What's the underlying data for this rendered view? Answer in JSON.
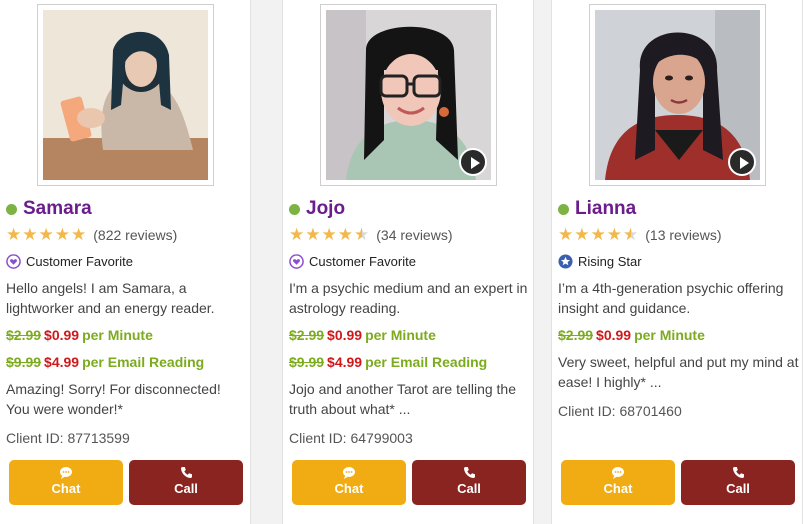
{
  "cards": [
    {
      "name": "Samara",
      "reviews": "(822 reviews)",
      "rating": 5,
      "badge": "Customer Favorite",
      "badge_icon": "heart-icon",
      "bio": "Hello angels! I am Samara, a lightworker and an energy reader.",
      "minute_old": "$2.99",
      "minute_new": "$0.99",
      "minute_unit": "per Minute",
      "email_old": "$9.99",
      "email_new": "$4.99",
      "email_unit": "per Email Reading",
      "review": "Amazing! Sorry! For disconnected! You were wonder!*",
      "client_id": "Client ID: 87713599",
      "chat_label": "Chat",
      "call_label": "Call",
      "has_video": false
    },
    {
      "name": "Jojo",
      "reviews": "(34 reviews)",
      "rating": 4.5,
      "badge": "Customer Favorite",
      "badge_icon": "heart-icon",
      "bio": "I'm a psychic medium and an expert in astrology reading.",
      "minute_old": "$2.99",
      "minute_new": "$0.99",
      "minute_unit": "per Minute",
      "email_old": "$9.99",
      "email_new": "$4.99",
      "email_unit": "per Email Reading",
      "review": "Jojo and another Tarot are telling the truth about what* ...",
      "client_id": "Client ID: 64799003",
      "chat_label": "Chat",
      "call_label": "Call",
      "has_video": true
    },
    {
      "name": "Lianna",
      "reviews": "(13 reviews)",
      "rating": 4.5,
      "badge": "Rising Star",
      "badge_icon": "star-badge-icon",
      "bio": "I’m a 4th-generation psychic offering insight and guidance.",
      "minute_old": "$2.99",
      "minute_new": "$0.99",
      "minute_unit": "per Minute",
      "review": "Very sweet, helpful and put my mind at ease! I highly* ...",
      "client_id": "Client ID: 68701460",
      "chat_label": "Chat",
      "call_label": "Call",
      "has_video": true
    }
  ],
  "colors": {
    "name": "#6b1d8c",
    "online": "#7cb342",
    "price_old": "#7cab1e",
    "price_new": "#d0181b",
    "chat_button": "#f0ac12",
    "call_button": "#8a2420",
    "star": "#f2b84b"
  }
}
